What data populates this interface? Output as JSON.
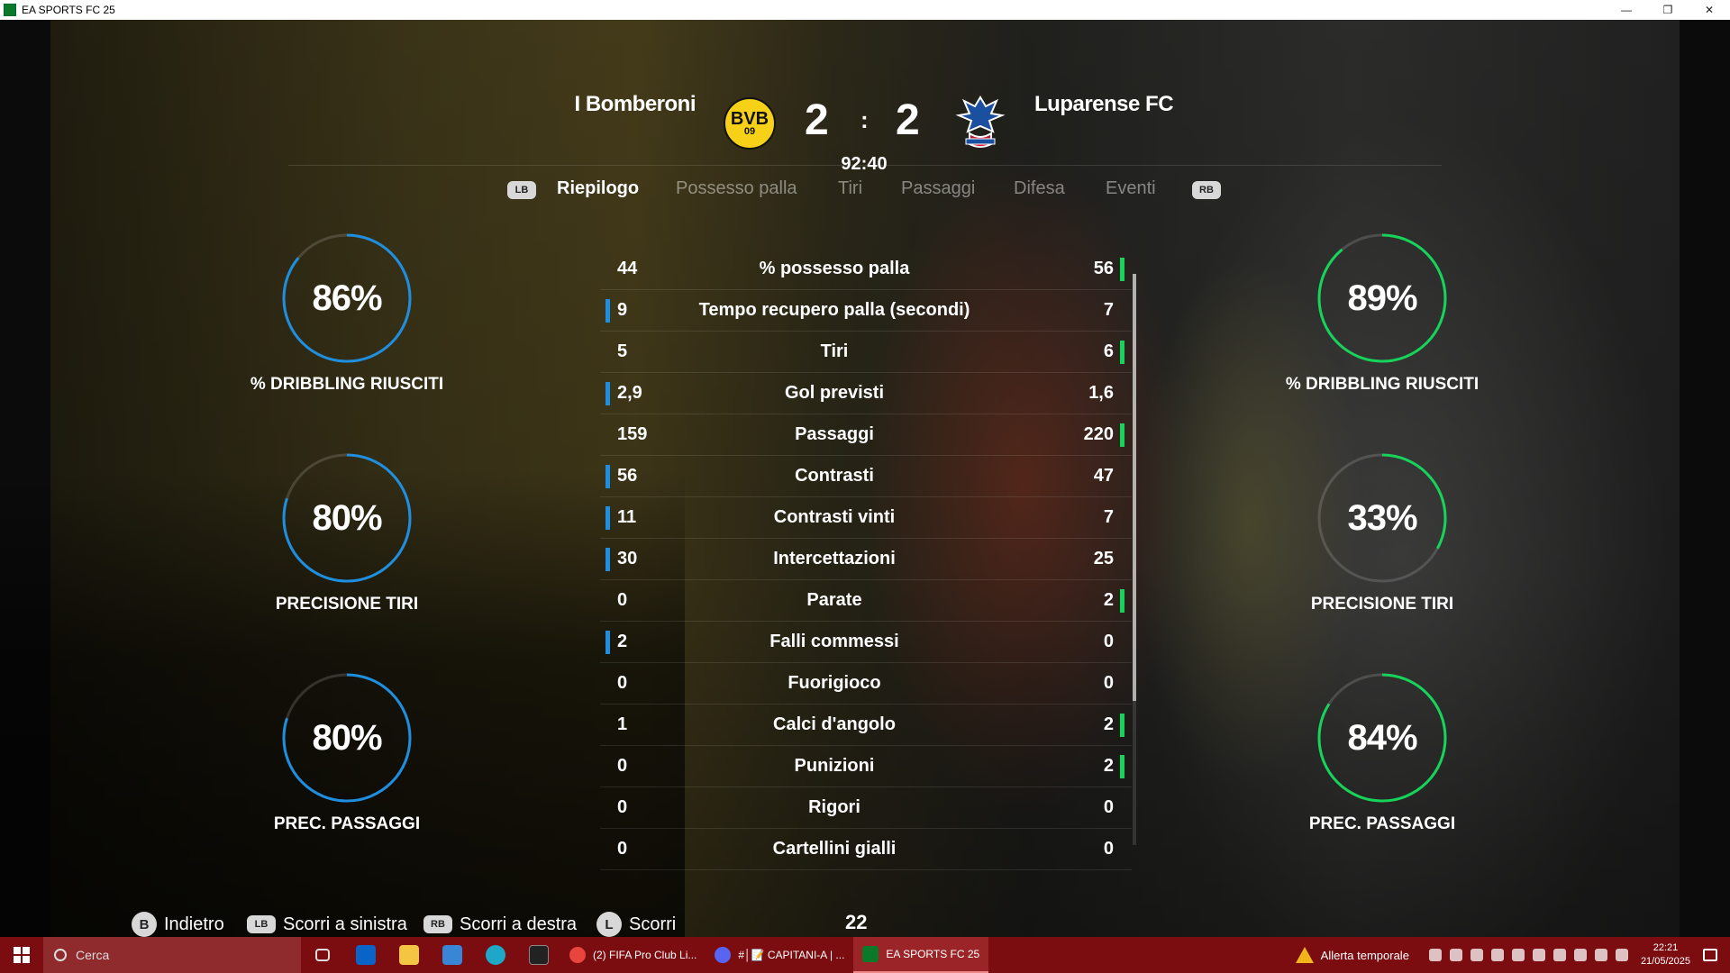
{
  "window": {
    "title": "EA SPORTS FC 25",
    "controls": [
      "—",
      "❐",
      "✕"
    ]
  },
  "match": {
    "home_team": "I Bomberoni",
    "away_team": "Luparense FC",
    "home_score": "2",
    "away_score": "2",
    "separator": ":",
    "clock": "92:40",
    "home_crest_text": "BVB",
    "home_crest_sub": "09"
  },
  "tabs": {
    "lb": "LB",
    "rb": "RB",
    "items": [
      "Riepilogo",
      "Possesso palla",
      "Tiri",
      "Passaggi",
      "Difesa",
      "Eventi"
    ],
    "active": "Riepilogo"
  },
  "rings": {
    "home": [
      {
        "value": "86%",
        "label": "% DRIBBLING RIUSCITI",
        "fraction": 0.86
      },
      {
        "value": "80%",
        "label": "PRECISIONE TIRI",
        "fraction": 0.8
      },
      {
        "value": "80%",
        "label": "PREC. PASSAGGI",
        "fraction": 0.8
      }
    ],
    "away": [
      {
        "value": "89%",
        "label": "% DRIBBLING RIUSCITI",
        "fraction": 0.89
      },
      {
        "value": "33%",
        "label": "PRECISIONE TIRI",
        "fraction": 0.33
      },
      {
        "value": "84%",
        "label": "PREC. PASSAGGI",
        "fraction": 0.84
      }
    ],
    "home_color": "#1e8fe0",
    "away_color": "#16d35a"
  },
  "stats": [
    {
      "name": "% possesso palla",
      "home": "44",
      "away": "56",
      "leader": "away"
    },
    {
      "name": "Tempo recupero palla (secondi)",
      "home": "9",
      "away": "7",
      "leader": "home"
    },
    {
      "name": "Tiri",
      "home": "5",
      "away": "6",
      "leader": "away"
    },
    {
      "name": "Gol previsti",
      "home": "2,9",
      "away": "1,6",
      "leader": "home"
    },
    {
      "name": "Passaggi",
      "home": "159",
      "away": "220",
      "leader": "away"
    },
    {
      "name": "Contrasti",
      "home": "56",
      "away": "47",
      "leader": "home"
    },
    {
      "name": "Contrasti vinti",
      "home": "11",
      "away": "7",
      "leader": "home"
    },
    {
      "name": "Intercettazioni",
      "home": "30",
      "away": "25",
      "leader": "home"
    },
    {
      "name": "Parate",
      "home": "0",
      "away": "2",
      "leader": "away"
    },
    {
      "name": "Falli commessi",
      "home": "2",
      "away": "0",
      "leader": "home"
    },
    {
      "name": "Fuorigioco",
      "home": "0",
      "away": "0",
      "leader": "none"
    },
    {
      "name": "Calci d'angolo",
      "home": "1",
      "away": "2",
      "leader": "away"
    },
    {
      "name": "Punizioni",
      "home": "0",
      "away": "2",
      "leader": "away"
    },
    {
      "name": "Rigori",
      "home": "0",
      "away": "0",
      "leader": "none"
    },
    {
      "name": "Cartellini gialli",
      "home": "0",
      "away": "0",
      "leader": "none"
    }
  ],
  "hints": {
    "back_btn": "B",
    "back": "Indietro",
    "left_btn": "LB",
    "left": "Scorri a sinistra",
    "right_btn": "RB",
    "right": "Scorri a destra",
    "scroll_btn": "L",
    "scroll": "Scorri",
    "page": "22"
  },
  "taskbar": {
    "search_placeholder": "Cerca",
    "apps": [
      {
        "label": "(2) FIFA Pro Club Li...",
        "color": "#e8453c"
      },
      {
        "label": "#│📝 CAPITANI-A | ...",
        "color": "#5865f2"
      },
      {
        "label": "EA SPORTS FC 25",
        "color": "#0a7a2a"
      }
    ],
    "alert": "Allerta temporale",
    "time": "22:21",
    "date": "21/05/2025"
  }
}
